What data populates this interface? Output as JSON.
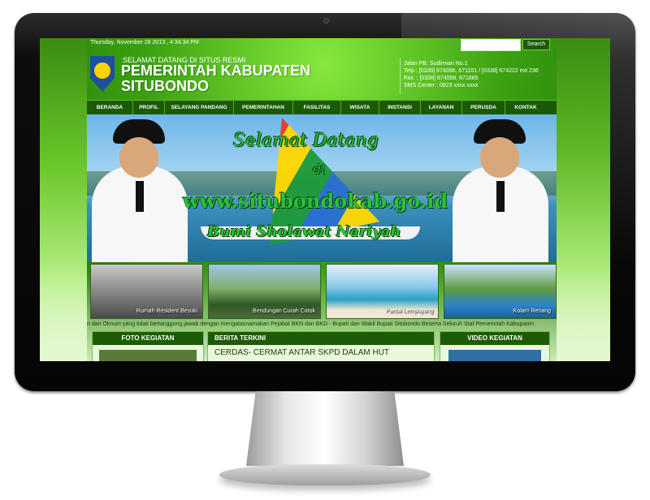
{
  "topbar": {
    "date": "Thursday, November 28 2013 , 4:34:34 PM",
    "search_placeholder": "",
    "search_button": "Search"
  },
  "header": {
    "welcome": "SELAMAT DATANG DI SITUS RESMI",
    "title": "PEMERINTAH KABUPATEN",
    "subtitle": "SITUBONDO",
    "contact": [
      "Jalan PB. Sudirman No.1",
      "Telp : [0338] 674096, 671161 / [0338] 674222 ext 236",
      "Fax. : [0338] 674096, 671885",
      "SMS Center : 0823 xxxx xxxx"
    ]
  },
  "nav": {
    "items": [
      "BERANDA",
      "PROFIL",
      "SELAYANG PANDANG",
      "PEMERINTAHAN",
      "FASILITAS",
      "WISATA",
      "INSTANSI",
      "LAYANAN",
      "PERUSDA",
      "KONTAK"
    ]
  },
  "banner": {
    "line1": "Selamat Datang",
    "line2": "di",
    "line3": "www.situbondokab.go.id",
    "line4": "Bumi Sholawat Nariyah"
  },
  "thumbnails": [
    {
      "caption": "Rumah Resident Besuki"
    },
    {
      "caption": "Bendungan Curah Cotok"
    },
    {
      "caption": "Pantai Lempuyang"
    },
    {
      "caption": "Kolam Renang"
    }
  ],
  "marquee": "n dari Oknum yang tidak bertanggung jawab dengan mengatasnamakan Pejabat BKN dan BKD - Bupati dan Wakil Bupati Situbondo Beserta Seluruh Staf Pemerintah Kabupaten",
  "panels": {
    "foto": {
      "title": "FOTO KEGIATAN"
    },
    "berita": {
      "title": "BERITA TERKINI",
      "headline": "CERDAS- CERMAT ANTAR SKPD DALAM HUT"
    },
    "video": {
      "title": "VIDEO KEGIATAN"
    }
  },
  "colors": {
    "nav_bg": "#1a5a05",
    "page_green": "#3aa010",
    "panel_head": "#1d5a06",
    "banner_text": "#2cc23a"
  }
}
